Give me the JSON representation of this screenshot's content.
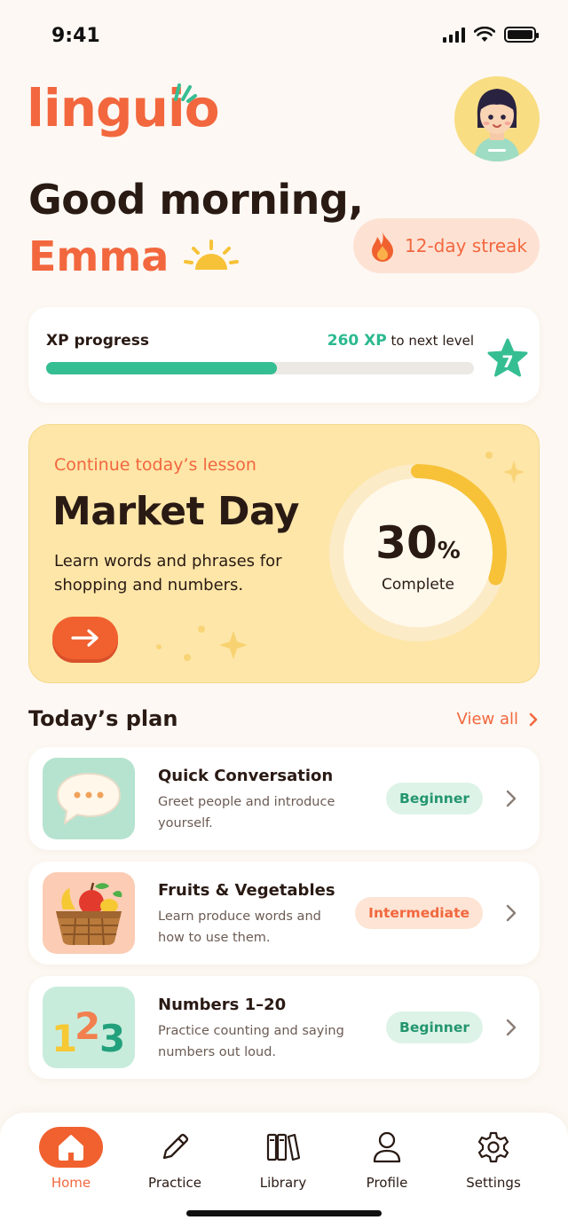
{
  "status_bar": {
    "time": "9:41"
  },
  "app": {
    "logo": "linguio"
  },
  "greeting": {
    "line1": "Good morning,",
    "name": "Emma"
  },
  "streak": {
    "label": "12-day streak"
  },
  "xp": {
    "title": "XP progress",
    "value": "260 XP",
    "suffix": "to next level",
    "progress": 0.54,
    "level": "7"
  },
  "lesson": {
    "eyebrow": "Continue today’s lesson",
    "title": "Market Day",
    "description": "Learn words and phrases for shopping and numbers.",
    "percent": "30",
    "percent_sign": "%",
    "percent_label": "Complete",
    "progress": 0.3
  },
  "plan": {
    "title": "Today’s plan",
    "view_all": "View all",
    "items": [
      {
        "title": "Quick Conversation",
        "description": "Greet people and introduce yourself.",
        "level": "Beginner",
        "icon": "speech-bubble-icon"
      },
      {
        "title": "Fruits & Vegetables",
        "description": "Learn produce words and how to use them.",
        "level": "Intermediate",
        "icon": "fruit-basket-icon"
      },
      {
        "title": "Numbers 1–20",
        "description": "Practice counting and saying numbers out loud.",
        "level": "Beginner",
        "icon": "numbers-123-icon"
      }
    ]
  },
  "tabs": [
    {
      "label": "Home",
      "icon": "home-icon",
      "active": true
    },
    {
      "label": "Practice",
      "icon": "pencil-icon"
    },
    {
      "label": "Library",
      "icon": "books-icon"
    },
    {
      "label": "Profile",
      "icon": "person-icon"
    },
    {
      "label": "Settings",
      "icon": "gear-icon"
    }
  ],
  "colors": {
    "accent": "#f2673e",
    "green": "#36be93",
    "lesson_bg": "#fde6a8",
    "ring": "#f7c238"
  }
}
